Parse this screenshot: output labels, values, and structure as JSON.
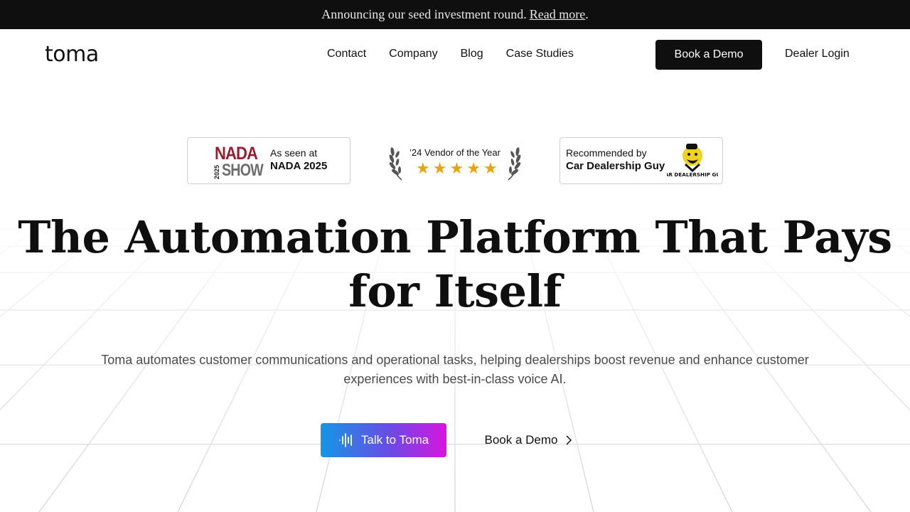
{
  "announcement": {
    "text": "Announcing our seed investment round.",
    "link": "Read more",
    "trailing": "."
  },
  "nav": {
    "logo": "toma",
    "links": [
      "Contact",
      "Company",
      "Blog",
      "Case Studies"
    ],
    "cta": "Book a Demo",
    "login": "Dealer Login"
  },
  "badges": {
    "nada": {
      "logo_top": "NADA",
      "logo_year": "2025",
      "logo_bottom": "SHOW",
      "line1": "As seen at",
      "line2": "NADA 2025"
    },
    "award": {
      "label": "’24 Vendor of the Year",
      "stars": 5
    },
    "cdg": {
      "line1": "Recommended by",
      "line2": "Car Dealership Guy",
      "logo_text": "CAR DEALERSHIP GUY"
    }
  },
  "hero": {
    "title_line1": "The Automation Platform That Pays",
    "title_line2": "for Itself",
    "subtitle": "Toma automates customer communications and operational tasks, helping dealerships boost revenue and enhance customer experiences with best-in-class voice AI.",
    "primary_cta": "Talk to Toma",
    "secondary_cta": "Book a Demo"
  },
  "icons": {
    "talk": "sound-wave-icon",
    "arrow": "chevron-right-icon",
    "star": "star-icon",
    "laurel": "laurel-icon"
  },
  "colors": {
    "announce_bg": "#0f0f0f",
    "cta_bg": "#0f0f0f",
    "star": "#e8a40c",
    "nada_red": "#9b1c2c",
    "gradient_start": "#1596e6",
    "gradient_end": "#d814e0"
  }
}
